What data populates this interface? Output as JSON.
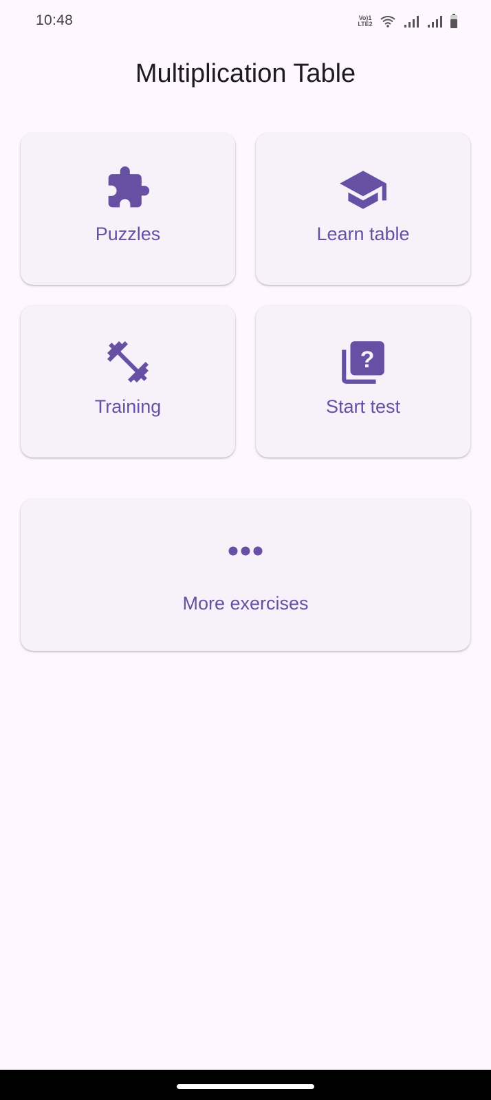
{
  "status_bar": {
    "time": "10:48",
    "network_badge_line1": "Vo)1",
    "network_badge_line2": "LTE2"
  },
  "app": {
    "title": "Multiplication Table"
  },
  "menu": {
    "puzzles": {
      "label": "Puzzles",
      "icon": "puzzle-icon"
    },
    "learn": {
      "label": "Learn table",
      "icon": "graduation-cap-icon"
    },
    "training": {
      "label": "Training",
      "icon": "dumbbell-icon"
    },
    "test": {
      "label": "Start test",
      "icon": "quiz-icon"
    },
    "more": {
      "label": "More exercises",
      "icon": "more-horizontal-icon"
    }
  },
  "colors": {
    "background": "#FEF7FF",
    "card": "#F7F2FA",
    "accent": "#6750A4",
    "text": "#1D1B20"
  }
}
